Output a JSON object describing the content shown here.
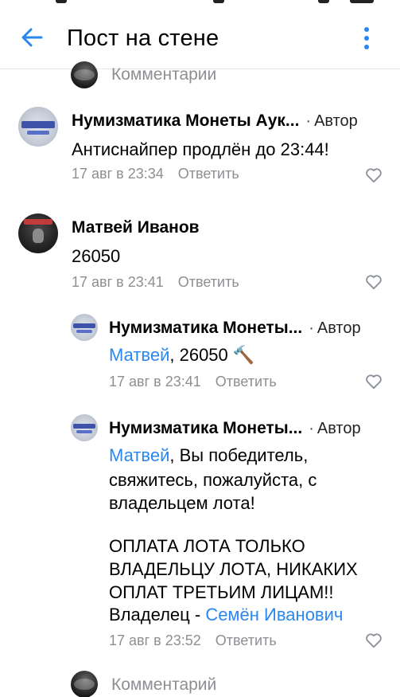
{
  "header": {
    "title": "Пост на стене"
  },
  "top_input": {
    "placeholder": "Комментарии"
  },
  "bottom_input": {
    "placeholder": "Комментарий"
  },
  "comments": [
    {
      "author": "Нумизматика Монеты Аук...",
      "tag": "Автор",
      "text": "Антиснайпер продлён до 23:44!",
      "time": "17 авг в 23:34",
      "reply": "Ответить"
    },
    {
      "author": "Матвей Иванов",
      "tag": "",
      "text": "26050",
      "time": "17 авг в 23:41",
      "reply": "Ответить"
    },
    {
      "author": "Нумизматика Монеты...",
      "tag": "Автор",
      "mention": "Матвей",
      "text": ", 26050 🔨",
      "time": "17 авг в 23:41",
      "reply": "Ответить"
    },
    {
      "author": "Нумизматика Монеты...",
      "tag": "Автор",
      "mention": "Матвей",
      "line1": ", Вы победитель,",
      "line2": "свяжитесь, пожалуйста, с",
      "line3": "владельцем лота!",
      "line4": "ОПЛАТА ЛОТА ТОЛЬКО",
      "line5": "ВЛАДЕЛЬЦУ ЛОТА, НИКАКИХ",
      "line6": "ОПЛАТ ТРЕТЬИМ ЛИЦАМ!!",
      "line7_prefix": "Владелец - ",
      "owner_link": "Семён Иванович",
      "time": "17 авг в 23:52",
      "reply": "Ответить"
    }
  ],
  "icons": {
    "back": "arrow-left-icon",
    "more": "more-vertical-icon",
    "like": "heart-outline-icon"
  },
  "colors": {
    "accent": "#2a87f0",
    "secondary_text": "#8e8e93",
    "like_icon": "#8a8f99"
  }
}
